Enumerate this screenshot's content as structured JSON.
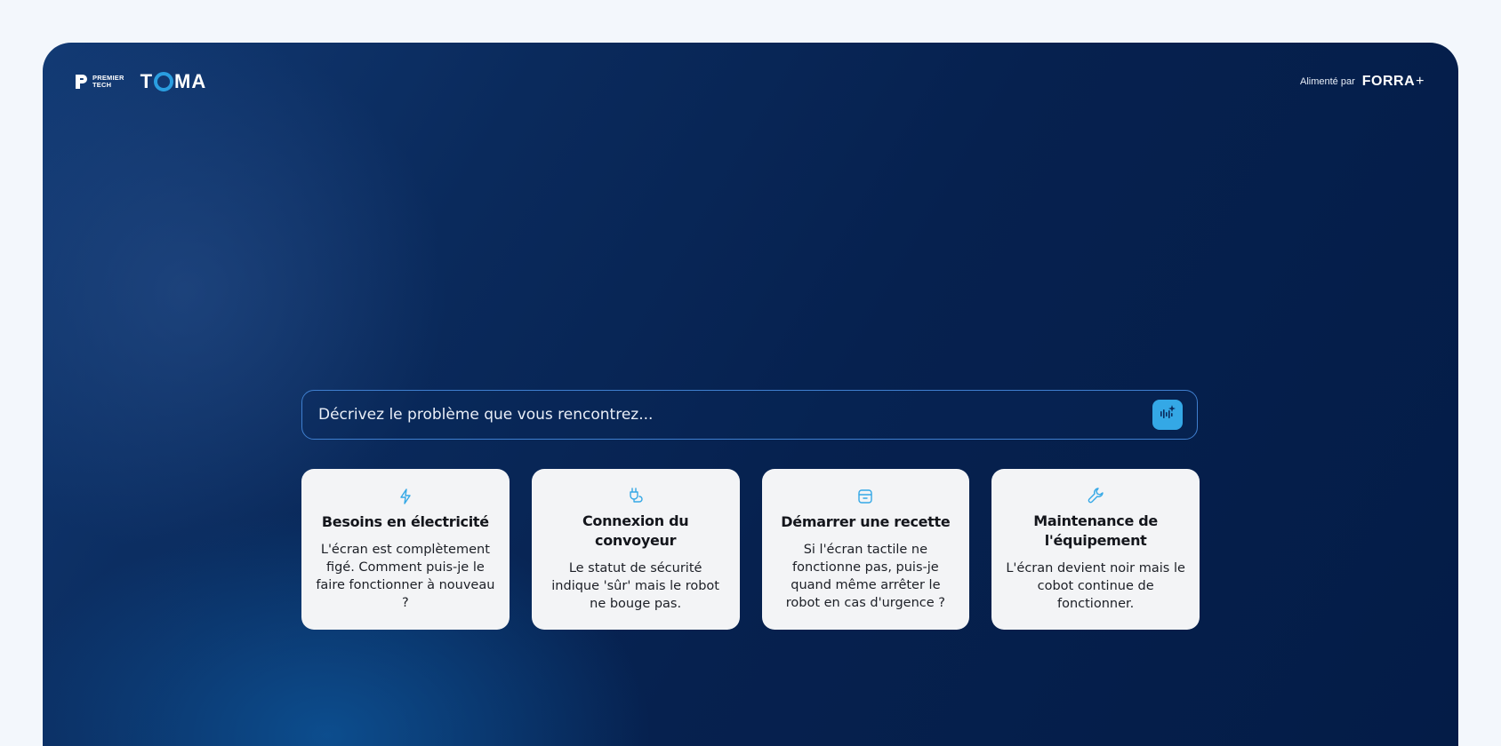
{
  "header": {
    "brand_words": [
      "PREMIER",
      "TECH"
    ],
    "product_prefix": "T",
    "product_suffix": "MA",
    "powered_label": "Alimenté par",
    "powered_brand": "FORRA",
    "powered_brand_mark": "+"
  },
  "search": {
    "placeholder": "Décrivez le problème que vous rencontrez...",
    "value": "",
    "button_icon": "audio-sparkle-icon"
  },
  "cards": [
    {
      "icon": "bolt-icon",
      "title": "Besoins en électricité",
      "description": "L'écran est complètement figé. Comment puis-je le faire fonctionner à nouveau ?"
    },
    {
      "icon": "plug-icon",
      "title": "Connexion du convoyeur",
      "description": "Le statut de sécurité indique 'sûr' mais le robot ne bouge pas."
    },
    {
      "icon": "package-icon",
      "title": "Démarrer une recette",
      "description": "Si l'écran tactile ne fonctionne pas, puis-je quand même arrêter le robot en cas d'urgence ?"
    },
    {
      "icon": "wrench-icon",
      "title": "Maintenance de l'équipement",
      "description": "L'écran devient noir mais le cobot continue de fonctionner."
    }
  ],
  "colors": {
    "background": "#f3f7fc",
    "panel": "#06214f",
    "accent": "#34a8e6",
    "card": "#f3f4f6"
  }
}
